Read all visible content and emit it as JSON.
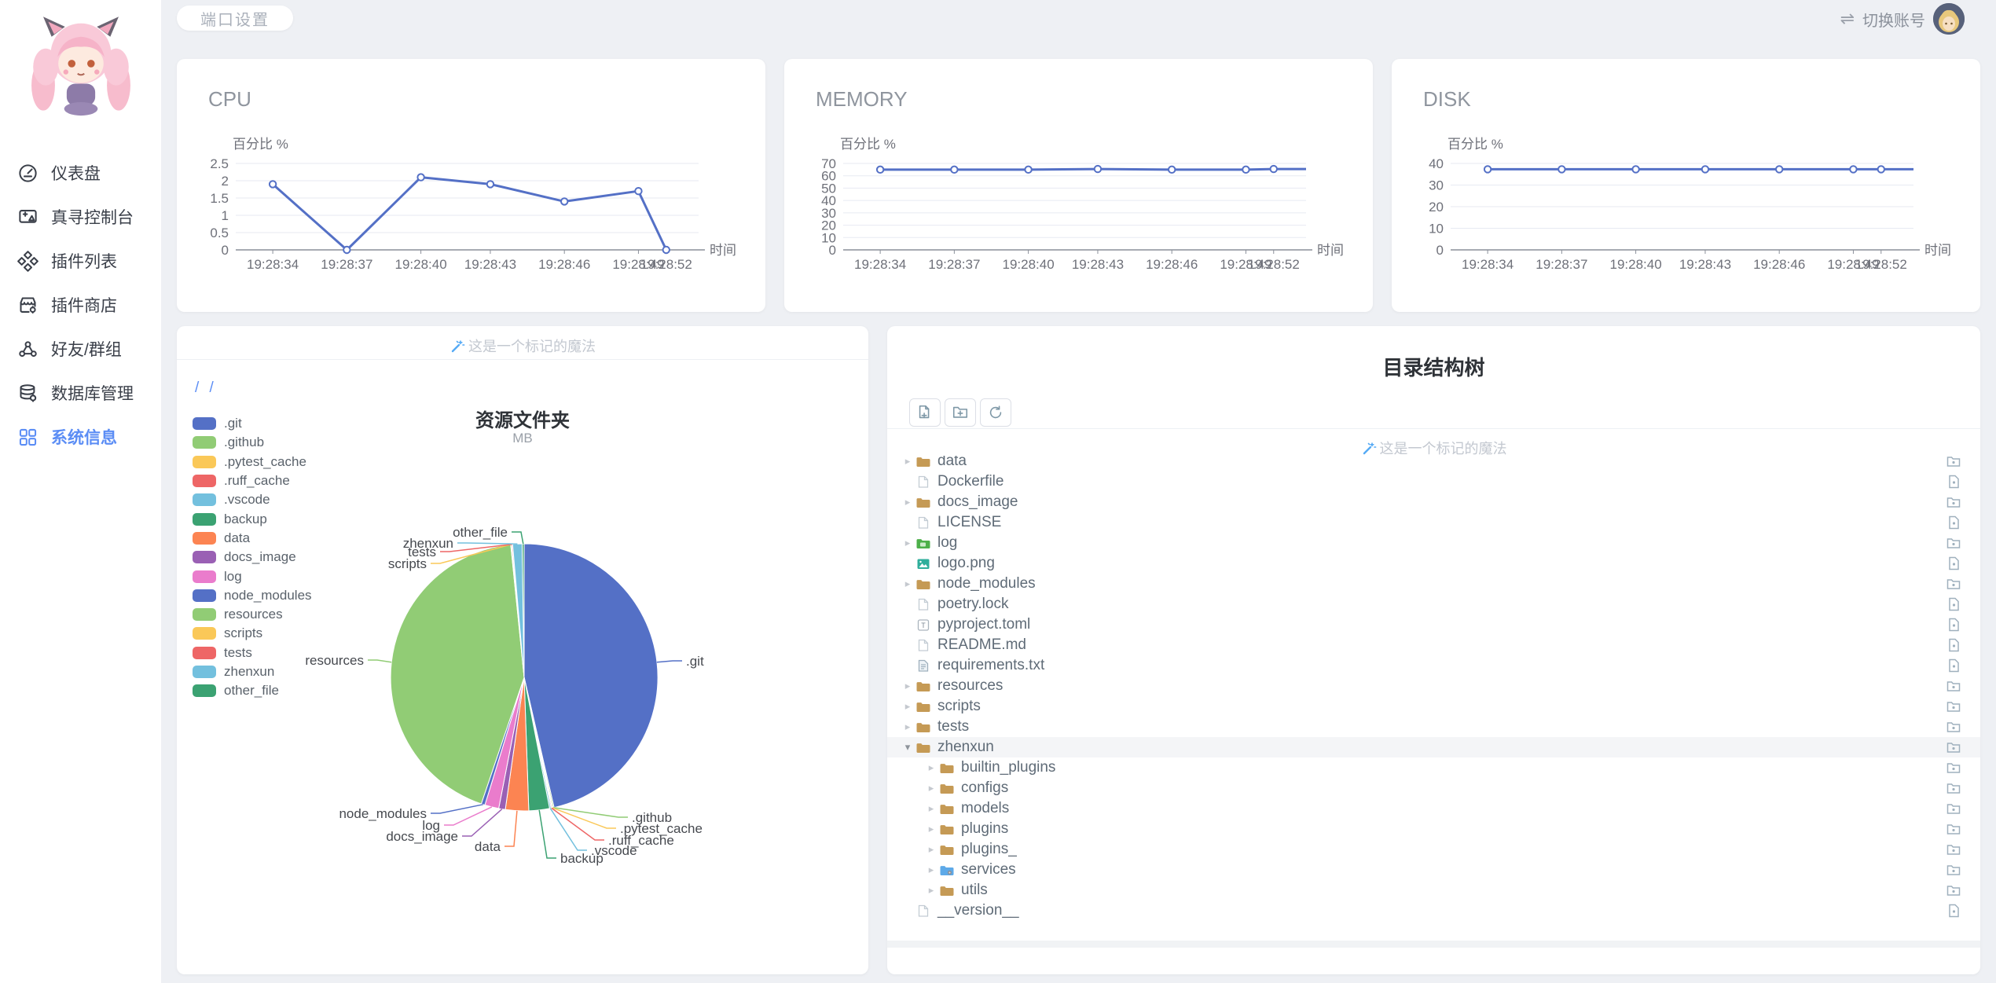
{
  "topbar": {
    "port_settings_label": "端口设置",
    "switch_icon": "⇌",
    "switch_account_label": "切换账号"
  },
  "sidebar": {
    "active_index": 6,
    "items": [
      {
        "label": "仪表盘",
        "icon": "gauge-icon"
      },
      {
        "label": "真寻控制台",
        "icon": "console-icon"
      },
      {
        "label": "插件列表",
        "icon": "plugins-icon"
      },
      {
        "label": "插件商店",
        "icon": "store-icon"
      },
      {
        "label": "好友/群组",
        "icon": "friends-icon"
      },
      {
        "label": "数据库管理",
        "icon": "database-icon"
      },
      {
        "label": "系统信息",
        "icon": "system-grid-icon"
      }
    ]
  },
  "watermark_text": "这是一个标记的魔法",
  "resource_card": {
    "breadcrumb": "/ /"
  },
  "tree_card": {
    "title": "目录结构树",
    "toolbar_icons": [
      "new-file-icon",
      "new-folder-icon",
      "refresh-icon"
    ],
    "rows": [
      {
        "name": "data",
        "level": 0,
        "kind": "folder",
        "expandable": true
      },
      {
        "name": "Dockerfile",
        "level": 0,
        "kind": "file"
      },
      {
        "name": "docs_image",
        "level": 0,
        "kind": "folder",
        "expandable": true
      },
      {
        "name": "LICENSE",
        "level": 0,
        "kind": "file"
      },
      {
        "name": "log",
        "level": 0,
        "kind": "folder-log",
        "expandable": true
      },
      {
        "name": "logo.png",
        "level": 0,
        "kind": "image"
      },
      {
        "name": "node_modules",
        "level": 0,
        "kind": "folder",
        "expandable": true
      },
      {
        "name": "poetry.lock",
        "level": 0,
        "kind": "file"
      },
      {
        "name": "pyproject.toml",
        "level": 0,
        "kind": "toml"
      },
      {
        "name": "README.md",
        "level": 0,
        "kind": "file"
      },
      {
        "name": "requirements.txt",
        "level": 0,
        "kind": "textfile"
      },
      {
        "name": "resources",
        "level": 0,
        "kind": "folder",
        "expandable": true
      },
      {
        "name": "scripts",
        "level": 0,
        "kind": "folder",
        "expandable": true
      },
      {
        "name": "tests",
        "level": 0,
        "kind": "folder",
        "expandable": true
      },
      {
        "name": "zhenxun",
        "level": 0,
        "kind": "folder",
        "expandable": true,
        "expanded": true,
        "selected": true
      },
      {
        "name": "builtin_plugins",
        "level": 1,
        "kind": "folder",
        "expandable": true
      },
      {
        "name": "configs",
        "level": 1,
        "kind": "folder",
        "expandable": true
      },
      {
        "name": "models",
        "level": 1,
        "kind": "folder",
        "expandable": true
      },
      {
        "name": "plugins",
        "level": 1,
        "kind": "folder",
        "expandable": true
      },
      {
        "name": "plugins_",
        "level": 1,
        "kind": "folder",
        "expandable": true
      },
      {
        "name": "services",
        "level": 1,
        "kind": "folder-services",
        "expandable": true
      },
      {
        "name": "utils",
        "level": 1,
        "kind": "folder",
        "expandable": true
      },
      {
        "name": "__version__",
        "level": 0,
        "kind": "file"
      }
    ]
  },
  "colors": {
    "accent": "#5b8df5",
    "line": "#5470c6",
    "palette": [
      "#5470c6",
      "#91cc75",
      "#fac858",
      "#ee6666",
      "#73c0de",
      "#3ba272",
      "#fc8452",
      "#9a60b4",
      "#ea7ccc"
    ]
  },
  "chart_data": [
    {
      "id": "cpu",
      "type": "line",
      "title": "CPU",
      "ylabel": "百分比 %",
      "xlabel": "时间",
      "x": [
        "19:28:34",
        "19:28:37",
        "19:28:40",
        "19:28:43",
        "19:28:46",
        "19:28:49",
        "19:28:52"
      ],
      "values": [
        1.9,
        0,
        2.1,
        1.9,
        1.4,
        1.7,
        0
      ],
      "ylim": [
        0,
        2.5
      ],
      "ytick_step": 0.5,
      "grid": true,
      "extend_to_edge": false
    },
    {
      "id": "memory",
      "type": "line",
      "title": "MEMORY",
      "ylabel": "百分比 %",
      "xlabel": "时间",
      "x": [
        "19:28:34",
        "19:28:37",
        "19:28:40",
        "19:28:43",
        "19:28:46",
        "19:28:49",
        "19:28:52"
      ],
      "values": [
        65,
        65,
        65,
        65.5,
        65,
        65,
        65.5
      ],
      "ylim": [
        0,
        70
      ],
      "ytick_step": 10,
      "grid": true,
      "extend_to_edge": true
    },
    {
      "id": "disk",
      "type": "line",
      "title": "DISK",
      "ylabel": "百分比 %",
      "xlabel": "时间",
      "x": [
        "19:28:34",
        "19:28:37",
        "19:28:40",
        "19:28:43",
        "19:28:46",
        "19:28:49",
        "19:28:52"
      ],
      "values": [
        37.3,
        37.3,
        37.3,
        37.3,
        37.3,
        37.3,
        37.3
      ],
      "ylim": [
        0,
        40
      ],
      "ytick_step": 10,
      "grid": true,
      "extend_to_edge": true
    },
    {
      "id": "folders",
      "type": "pie",
      "title": "资源文件夹",
      "subtitle": "MB",
      "unit": "MB",
      "legend_position": "left",
      "slices": [
        {
          "label": ".git",
          "pct": 46.4
        },
        {
          "label": ".github",
          "pct": 0.15
        },
        {
          "label": ".pytest_cache",
          "pct": 0.1
        },
        {
          "label": ".ruff_cache",
          "pct": 0.12
        },
        {
          "label": ".vscode",
          "pct": 0.18
        },
        {
          "label": "backup",
          "pct": 2.5
        },
        {
          "label": "data",
          "pct": 2.8
        },
        {
          "label": "docs_image",
          "pct": 0.8
        },
        {
          "label": "log",
          "pct": 1.7
        },
        {
          "label": "node_modules",
          "pct": 0.45
        },
        {
          "label": "resources",
          "pct": 43.2
        },
        {
          "label": "scripts",
          "pct": 0.1
        },
        {
          "label": "tests",
          "pct": 0.12
        },
        {
          "label": "zhenxun",
          "pct": 1.15
        },
        {
          "label": "other_file",
          "pct": 0.23
        }
      ]
    }
  ]
}
